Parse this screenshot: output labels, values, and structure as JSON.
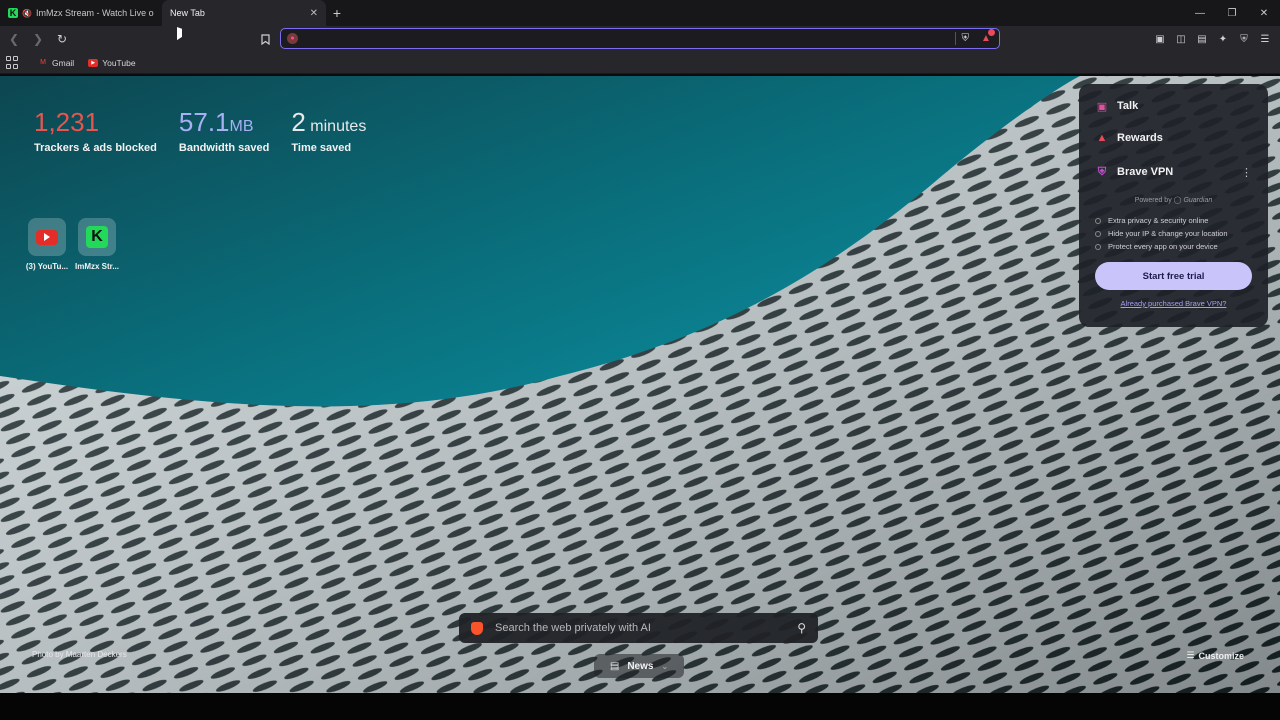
{
  "tabs": [
    {
      "title": "ImMzx Stream - Watch Live on K",
      "active": false
    },
    {
      "title": "New Tab",
      "active": true
    }
  ],
  "address": {
    "value": "",
    "placeholder": ""
  },
  "bookmarks": [
    {
      "label": "Gmail"
    },
    {
      "label": "YouTube"
    }
  ],
  "stats": [
    {
      "value": "1,231",
      "unit": "",
      "label": "Trackers & ads blocked",
      "color": "#e8554e"
    },
    {
      "value": "57.1",
      "unit": "MB",
      "label": "Bandwidth saved",
      "color": "#a7b0f5"
    },
    {
      "value": "2",
      "unit": "minutes",
      "label": "Time saved",
      "color": "#ffffff"
    }
  ],
  "top_sites": [
    {
      "label": "(3) YouTu...",
      "icon": "youtube-icon"
    },
    {
      "label": "ImMzx Str...",
      "icon": "kick-icon"
    }
  ],
  "panel": {
    "talk": "Talk",
    "rewards": "Rewards",
    "vpn": "Brave VPN",
    "powered": "Powered by",
    "powered_brand": "Guardian",
    "features": [
      "Extra privacy & security online",
      "Hide your IP & change your location",
      "Protect every app on your device"
    ],
    "trial": "Start free trial",
    "purchased": "Already purchased Brave VPN?"
  },
  "search": {
    "placeholder": "Search the web privately with AI"
  },
  "news": "News",
  "credit": "Photo by Maarten Deckers",
  "customize": "Customize",
  "colors": {
    "accent": "#7b6df2",
    "brave": "#fb542b"
  }
}
